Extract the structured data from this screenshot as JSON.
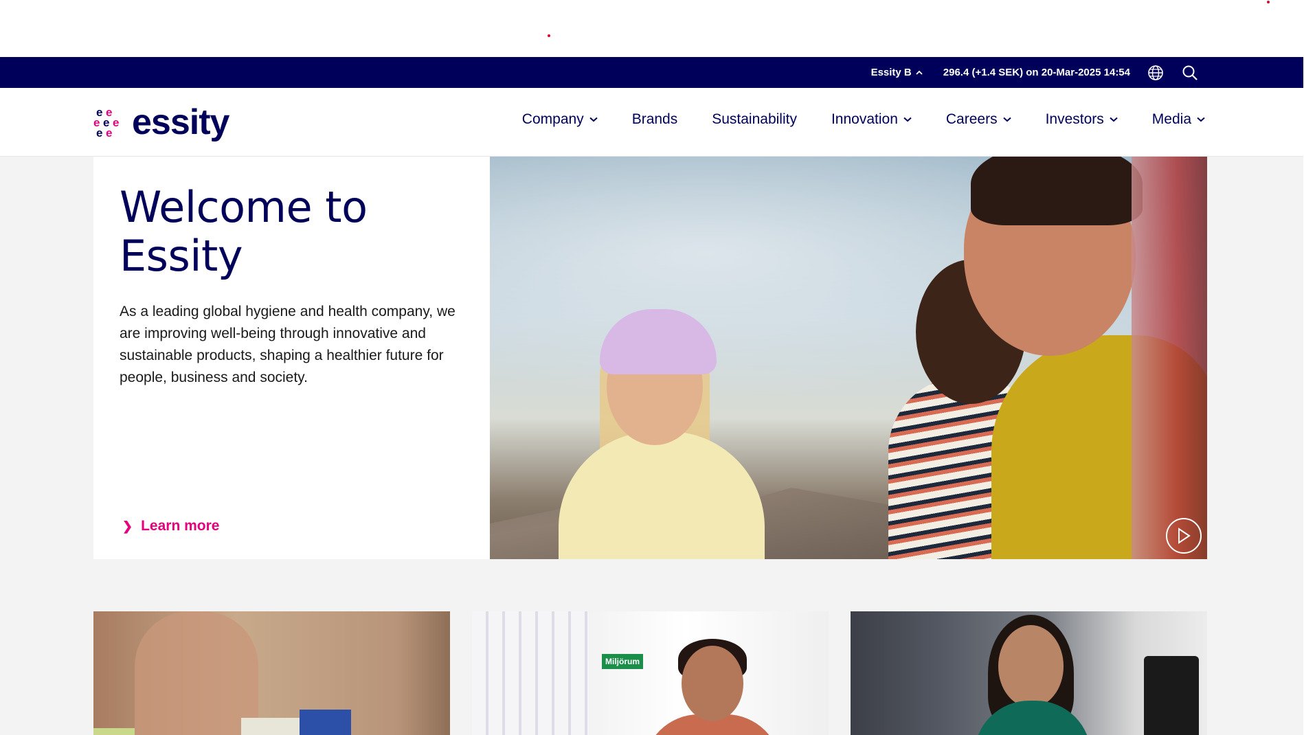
{
  "utility_bar": {
    "stock_label": "Essity B",
    "stock_quote": "296.4 (+1.4 SEK) on 20-Mar-2025 14:54"
  },
  "brand": {
    "name": "essity",
    "logo_glyph": "e"
  },
  "nav": {
    "items": [
      {
        "label": "Company",
        "has_dropdown": true
      },
      {
        "label": "Brands",
        "has_dropdown": false
      },
      {
        "label": "Sustainability",
        "has_dropdown": false
      },
      {
        "label": "Innovation",
        "has_dropdown": true
      },
      {
        "label": "Careers",
        "has_dropdown": true
      },
      {
        "label": "Investors",
        "has_dropdown": true
      },
      {
        "label": "Media",
        "has_dropdown": true
      }
    ]
  },
  "hero": {
    "title_line1": "Welcome to",
    "title_line2": "Essity",
    "body": "As a leading global hygiene and health company, we are improving well-being through innovative and sustainable products, shaping a healthier future for people, business and society.",
    "cta_label": "Learn more",
    "cta_arrow": "❯"
  },
  "cards": {
    "card2_sign": "Miljörum"
  },
  "colors": {
    "navy": "#00005a",
    "accent_pink": "#e5007e",
    "background_grey": "#f3f3f4"
  },
  "icons": {
    "stock_toggle": "chevron-up-icon",
    "language": "globe-icon",
    "search": "search-icon",
    "nav_dropdown": "chevron-down-icon",
    "video": "play-icon"
  }
}
